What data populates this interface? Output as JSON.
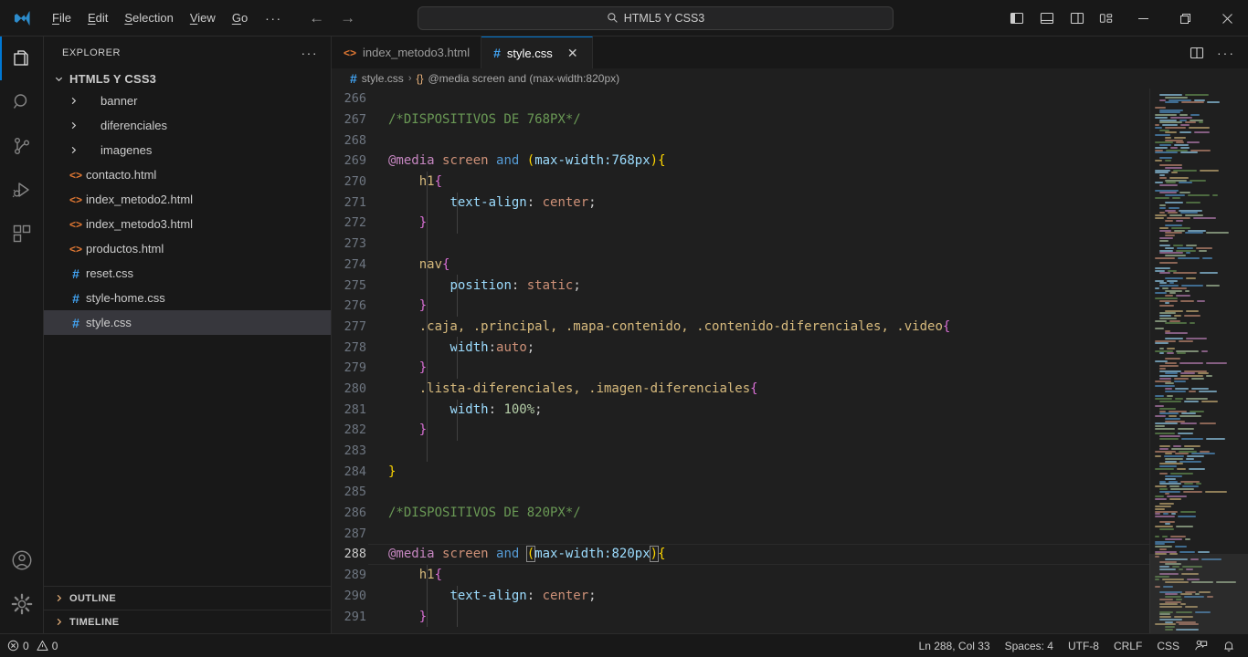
{
  "window": {
    "logo_icon": "vscode-logo-icon",
    "menu": [
      {
        "label": "File",
        "mnemonic": "F"
      },
      {
        "label": "Edit",
        "mnemonic": "E"
      },
      {
        "label": "Selection",
        "mnemonic": "S"
      },
      {
        "label": "View",
        "mnemonic": "V"
      },
      {
        "label": "Go",
        "mnemonic": "G"
      }
    ],
    "menu_overflow": "···",
    "back_arrow": "←",
    "forward_arrow": "→",
    "command_center": {
      "icon": "search-icon",
      "text": "HTML5 Y CSS3"
    },
    "layout_buttons": [
      "toggle-primary-sidebar-icon",
      "toggle-panel-icon",
      "toggle-secondary-sidebar-icon",
      "customize-layout-icon"
    ],
    "controls": {
      "minimize": "—",
      "restore": "restore-icon",
      "close": "✕"
    }
  },
  "activity_bar": {
    "items": [
      {
        "name": "explorer",
        "icon": "files-icon",
        "active": true
      },
      {
        "name": "search",
        "icon": "search-icon",
        "active": false
      },
      {
        "name": "source-control",
        "icon": "source-control-icon",
        "active": false
      },
      {
        "name": "run-debug",
        "icon": "run-and-debug-icon",
        "active": false
      },
      {
        "name": "extensions",
        "icon": "extensions-icon",
        "active": false
      }
    ],
    "bottom_items": [
      {
        "name": "accounts",
        "icon": "account-icon"
      },
      {
        "name": "manage",
        "icon": "gear-icon"
      }
    ]
  },
  "sidebar": {
    "title": "EXPLORER",
    "more_actions": "···",
    "root_folder": "HTML5 Y CSS3",
    "root_chevron": "⌄",
    "items": [
      {
        "label": "banner",
        "type": "folder",
        "icon": "chevron-right-icon",
        "selected": false
      },
      {
        "label": "diferenciales",
        "type": "folder",
        "icon": "chevron-right-icon",
        "selected": false
      },
      {
        "label": "imagenes",
        "type": "folder",
        "icon": "chevron-right-icon",
        "selected": false
      },
      {
        "label": "contacto.html",
        "type": "html",
        "icon": "html-file-icon",
        "selected": false
      },
      {
        "label": "index_metodo2.html",
        "type": "html",
        "icon": "html-file-icon",
        "selected": false
      },
      {
        "label": "index_metodo3.html",
        "type": "html",
        "icon": "html-file-icon",
        "selected": false
      },
      {
        "label": "productos.html",
        "type": "html",
        "icon": "html-file-icon",
        "selected": false
      },
      {
        "label": "reset.css",
        "type": "css",
        "icon": "css-file-icon",
        "selected": false
      },
      {
        "label": "style-home.css",
        "type": "css",
        "icon": "css-file-icon",
        "selected": false
      },
      {
        "label": "style.css",
        "type": "css",
        "icon": "css-file-icon",
        "selected": true
      }
    ],
    "sections": [
      {
        "label": "OUTLINE",
        "chevron": "›"
      },
      {
        "label": "TIMELINE",
        "chevron": "›"
      }
    ]
  },
  "editor": {
    "tabs": [
      {
        "label": "index_metodo3.html",
        "type": "html",
        "active": false,
        "has_close": false
      },
      {
        "label": "style.css",
        "type": "css",
        "active": true,
        "has_close": true,
        "close_glyph": "✕"
      }
    ],
    "tab_actions": [
      "split-editor-icon",
      "more-actions-icon"
    ],
    "breadcrumb": {
      "file_icon": "css-file-icon",
      "file": "style.css",
      "separator": "›",
      "symbol_icon": "{}",
      "symbol": "@media screen and (max-width:820px)"
    },
    "first_line_number": 266,
    "lines": [
      {
        "n": 266,
        "tokens": []
      },
      {
        "n": 267,
        "tokens": [
          {
            "t": "/*DISPOSITIVOS DE 768PX*/",
            "c": "t-comment"
          }
        ]
      },
      {
        "n": 268,
        "tokens": []
      },
      {
        "n": 269,
        "tokens": [
          {
            "t": "@media",
            "c": "t-at"
          },
          {
            "t": " ",
            "c": "t-punc"
          },
          {
            "t": "screen",
            "c": "t-media"
          },
          {
            "t": " ",
            "c": "t-punc"
          },
          {
            "t": "and",
            "c": "t-and"
          },
          {
            "t": " ",
            "c": "t-punc"
          },
          {
            "t": "(",
            "c": "t-paren"
          },
          {
            "t": "max-width:",
            "c": "t-feature"
          },
          {
            "t": "768px",
            "c": "t-feature"
          },
          {
            "t": ")",
            "c": "t-paren"
          },
          {
            "t": "{",
            "c": "t-brace"
          }
        ]
      },
      {
        "n": 270,
        "tokens": [
          {
            "t": "    ",
            "c": "t-punc"
          },
          {
            "t": "h1",
            "c": "t-tag"
          },
          {
            "t": "{",
            "c": "t-brace2"
          }
        ]
      },
      {
        "n": 271,
        "tokens": [
          {
            "t": "        ",
            "c": "t-punc"
          },
          {
            "t": "text-align",
            "c": "t-prop"
          },
          {
            "t": ": ",
            "c": "t-punc"
          },
          {
            "t": "center",
            "c": "t-val"
          },
          {
            "t": ";",
            "c": "t-punc"
          }
        ]
      },
      {
        "n": 272,
        "tokens": [
          {
            "t": "    ",
            "c": "t-punc"
          },
          {
            "t": "}",
            "c": "t-brace2"
          }
        ]
      },
      {
        "n": 273,
        "tokens": []
      },
      {
        "n": 274,
        "tokens": [
          {
            "t": "    ",
            "c": "t-punc"
          },
          {
            "t": "nav",
            "c": "t-tag"
          },
          {
            "t": "{",
            "c": "t-brace2"
          }
        ]
      },
      {
        "n": 275,
        "tokens": [
          {
            "t": "        ",
            "c": "t-punc"
          },
          {
            "t": "position",
            "c": "t-prop"
          },
          {
            "t": ": ",
            "c": "t-punc"
          },
          {
            "t": "static",
            "c": "t-val"
          },
          {
            "t": ";",
            "c": "t-punc"
          }
        ]
      },
      {
        "n": 276,
        "tokens": [
          {
            "t": "    ",
            "c": "t-punc"
          },
          {
            "t": "}",
            "c": "t-brace2"
          }
        ]
      },
      {
        "n": 277,
        "tokens": [
          {
            "t": "    ",
            "c": "t-punc"
          },
          {
            "t": ".caja, .principal, .mapa-contenido, .contenido-diferenciales, .video",
            "c": "t-sel"
          },
          {
            "t": "{",
            "c": "t-brace2"
          }
        ]
      },
      {
        "n": 278,
        "tokens": [
          {
            "t": "        ",
            "c": "t-punc"
          },
          {
            "t": "width",
            "c": "t-prop"
          },
          {
            "t": ":",
            "c": "t-punc"
          },
          {
            "t": "auto",
            "c": "t-val"
          },
          {
            "t": ";",
            "c": "t-punc"
          }
        ]
      },
      {
        "n": 279,
        "tokens": [
          {
            "t": "    ",
            "c": "t-punc"
          },
          {
            "t": "}",
            "c": "t-brace2"
          }
        ]
      },
      {
        "n": 280,
        "tokens": [
          {
            "t": "    ",
            "c": "t-punc"
          },
          {
            "t": ".lista-diferenciales, .imagen-diferenciales",
            "c": "t-sel"
          },
          {
            "t": "{",
            "c": "t-brace2"
          }
        ]
      },
      {
        "n": 281,
        "tokens": [
          {
            "t": "        ",
            "c": "t-punc"
          },
          {
            "t": "width",
            "c": "t-prop"
          },
          {
            "t": ": ",
            "c": "t-punc"
          },
          {
            "t": "100%",
            "c": "t-num"
          },
          {
            "t": ";",
            "c": "t-punc"
          }
        ]
      },
      {
        "n": 282,
        "tokens": [
          {
            "t": "    ",
            "c": "t-punc"
          },
          {
            "t": "}",
            "c": "t-brace2"
          }
        ]
      },
      {
        "n": 283,
        "tokens": []
      },
      {
        "n": 284,
        "tokens": [
          {
            "t": "}",
            "c": "t-brace"
          }
        ]
      },
      {
        "n": 285,
        "tokens": []
      },
      {
        "n": 286,
        "tokens": [
          {
            "t": "/*DISPOSITIVOS DE 820PX*/",
            "c": "t-comment"
          }
        ]
      },
      {
        "n": 287,
        "tokens": []
      },
      {
        "n": 288,
        "active": true,
        "tokens": [
          {
            "t": "@media",
            "c": "t-at"
          },
          {
            "t": " ",
            "c": "t-punc"
          },
          {
            "t": "screen",
            "c": "t-media"
          },
          {
            "t": " ",
            "c": "t-punc"
          },
          {
            "t": "and",
            "c": "t-and"
          },
          {
            "t": " ",
            "c": "t-punc"
          },
          {
            "t": "(",
            "c": "t-paren",
            "box": true
          },
          {
            "t": "max-width:",
            "c": "t-feature"
          },
          {
            "t": "820px",
            "c": "t-feature"
          },
          {
            "t": ")",
            "c": "t-paren",
            "box": true
          },
          {
            "t": "{",
            "c": "t-brace"
          }
        ]
      },
      {
        "n": 289,
        "tokens": [
          {
            "t": "    ",
            "c": "t-punc"
          },
          {
            "t": "h1",
            "c": "t-tag"
          },
          {
            "t": "{",
            "c": "t-brace2"
          }
        ]
      },
      {
        "n": 290,
        "tokens": [
          {
            "t": "        ",
            "c": "t-punc"
          },
          {
            "t": "text-align",
            "c": "t-prop"
          },
          {
            "t": ": ",
            "c": "t-punc"
          },
          {
            "t": "center",
            "c": "t-val"
          },
          {
            "t": ";",
            "c": "t-punc"
          }
        ]
      },
      {
        "n": 291,
        "tokens": [
          {
            "t": "    ",
            "c": "t-punc"
          },
          {
            "t": "}",
            "c": "t-brace2"
          }
        ]
      }
    ]
  },
  "status_bar": {
    "left": [
      {
        "name": "problems",
        "error_icon": "error-circle-icon",
        "errors": "0",
        "warning_icon": "warning-triangle-icon",
        "warnings": "0"
      }
    ],
    "right": [
      {
        "name": "cursor-position",
        "label": "Ln 288, Col 33"
      },
      {
        "name": "indentation",
        "label": "Spaces: 4"
      },
      {
        "name": "encoding",
        "label": "UTF-8"
      },
      {
        "name": "eol",
        "label": "CRLF"
      },
      {
        "name": "language-mode",
        "label": "CSS"
      },
      {
        "name": "feedback",
        "icon": "feedback-person-icon"
      },
      {
        "name": "notifications",
        "icon": "bell-icon"
      }
    ]
  },
  "colors": {
    "accent": "#0078d4",
    "titlebar_bg": "#181818",
    "editor_bg": "#1f1f1f",
    "sidebar_bg": "#181818",
    "selection_bg": "#37373d",
    "html_icon": "#e37933",
    "css_icon": "#42a5f5",
    "comment": "#6a9955",
    "at_rule": "#c586c0",
    "keyword": "#569cd6",
    "string": "#ce9178",
    "number": "#b5cea8",
    "bracket": "#ffd700"
  }
}
